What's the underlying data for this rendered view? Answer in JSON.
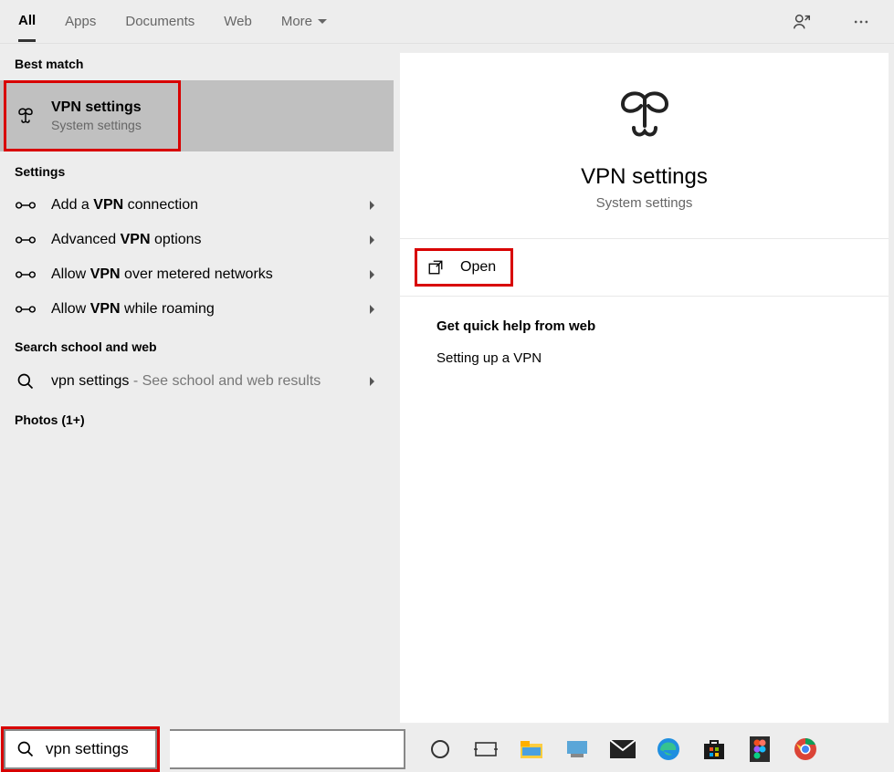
{
  "tabs": {
    "items": [
      {
        "label": "All",
        "active": true
      },
      {
        "label": "Apps"
      },
      {
        "label": "Documents"
      },
      {
        "label": "Web"
      },
      {
        "label": "More",
        "dropdown": true
      }
    ]
  },
  "sections": {
    "best_match": {
      "label": "Best match",
      "item": {
        "title_bold": "VPN settings",
        "subtitle": "System settings"
      }
    },
    "settings": {
      "label": "Settings",
      "items": [
        {
          "pre": "Add a ",
          "bold": "VPN",
          "post": " connection"
        },
        {
          "pre": "Advanced ",
          "bold": "VPN",
          "post": " options"
        },
        {
          "pre": "Allow ",
          "bold": "VPN",
          "post": " over metered networks"
        },
        {
          "pre": "Allow ",
          "bold": "VPN",
          "post": " while roaming"
        }
      ]
    },
    "school_web": {
      "label": "Search school and web",
      "item": {
        "query": "vpn settings",
        "suffix": " - See school and web results"
      }
    },
    "photos": {
      "label": "Photos (1+)"
    }
  },
  "preview": {
    "title": "VPN settings",
    "subtitle": "System settings",
    "open_label": "Open",
    "help_header": "Get quick help from web",
    "help_links": [
      "Setting up a VPN"
    ]
  },
  "search": {
    "value": "vpn settings"
  }
}
